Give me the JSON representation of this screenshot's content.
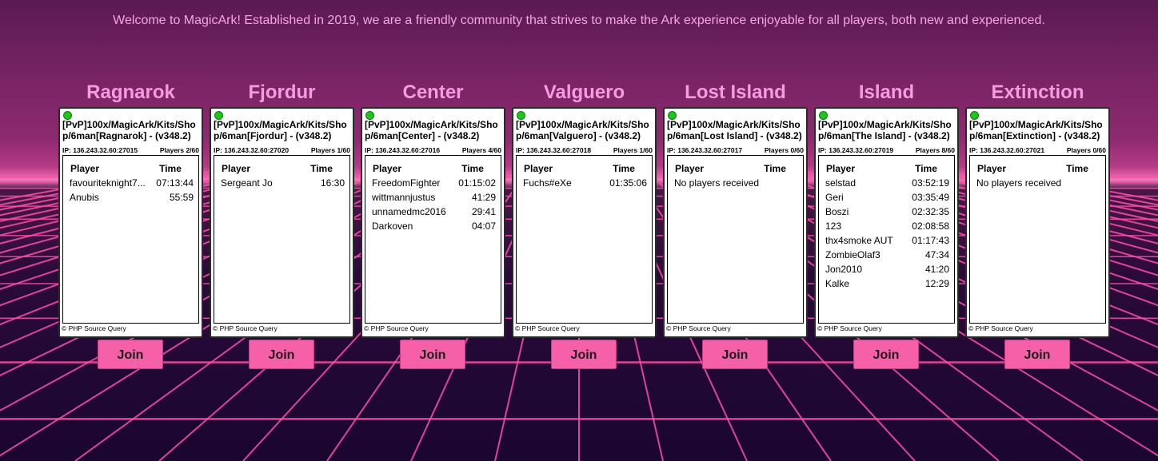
{
  "welcome_text": "Welcome to MagicArk! Established in 2019, we are a friendly community that strives to make the Ark experience enjoyable for all players, both new and experienced.",
  "colors": {
    "accent_pink": "#f69be0",
    "button_pink": "#f660a8",
    "status_online": "#1fc41f",
    "grid_line": "#ff4fa8"
  },
  "icons": {
    "status": "green-dot-icon"
  },
  "table_headers": {
    "player": "Player",
    "time": "Time"
  },
  "join_label": "Join",
  "footer_label": "© PHP Source Query",
  "servers": [
    {
      "name": "Ragnarok",
      "title": "[PvP]100x/MagicArk/Kits/Shop/6man[Ragnarok] - (v348.2)",
      "ip": "IP: 136.243.32.60:27015",
      "players_count": "Players 2/60",
      "players": [
        {
          "name": "favouriteknight7...",
          "time": "07:13:44"
        },
        {
          "name": "Anubis",
          "time": "55:59"
        }
      ],
      "empty_text": ""
    },
    {
      "name": "Fjordur",
      "title": "[PvP]100x/MagicArk/Kits/Shop/6man[Fjordur] - (v348.2)",
      "ip": "IP: 136.243.32.60:27020",
      "players_count": "Players 1/60",
      "players": [
        {
          "name": "Sergeant Jo",
          "time": "16:30"
        }
      ],
      "empty_text": ""
    },
    {
      "name": "Center",
      "title": "[PvP]100x/MagicArk/Kits/Shop/6man[Center] - (v348.2)",
      "ip": "IP: 136.243.32.60:27016",
      "players_count": "Players 4/60",
      "players": [
        {
          "name": "FreedomFighter",
          "time": "01:15:02"
        },
        {
          "name": "wittmannjustus",
          "time": "41:29"
        },
        {
          "name": "unnamedmc2016",
          "time": "29:41"
        },
        {
          "name": "Darkoven",
          "time": "04:07"
        }
      ],
      "empty_text": ""
    },
    {
      "name": "Valguero",
      "title": "[PvP]100x/MagicArk/Kits/Shop/6man[Valguero] - (v348.2)",
      "ip": "IP: 136.243.32.60:27018",
      "players_count": "Players 1/60",
      "players": [
        {
          "name": "Fuchs#eXe",
          "time": "01:35:06"
        }
      ],
      "empty_text": ""
    },
    {
      "name": "Lost Island",
      "title": "[PvP]100x/MagicArk/Kits/Shop/6man[Lost Island] - (v348.2)",
      "ip": "IP: 136.243.32.60:27017",
      "players_count": "Players 0/60",
      "players": [],
      "empty_text": "No players received"
    },
    {
      "name": "Island",
      "title": "[PvP]100x/MagicArk/Kits/Shop/6man[The Island] - (v348.2)",
      "ip": "IP: 136.243.32.60:27019",
      "players_count": "Players 8/60",
      "players": [
        {
          "name": "selstad",
          "time": "03:52:19"
        },
        {
          "name": "Geri",
          "time": "03:35:49"
        },
        {
          "name": "Boszi",
          "time": "02:32:35"
        },
        {
          "name": "123",
          "time": "02:08:58"
        },
        {
          "name": "thx4smoke AUT",
          "time": "01:17:43"
        },
        {
          "name": "ZombieOlaf3",
          "time": "47:34"
        },
        {
          "name": "Jon2010",
          "time": "41:20"
        },
        {
          "name": "Kalke",
          "time": "12:29"
        }
      ],
      "empty_text": ""
    },
    {
      "name": "Extinction",
      "title": "[PvP]100x/MagicArk/Kits/Shop/6man[Extinction] - (v348.2)",
      "ip": "IP: 136.243.32.60:27021",
      "players_count": "Players 0/60",
      "players": [],
      "empty_text": "No players received"
    }
  ]
}
